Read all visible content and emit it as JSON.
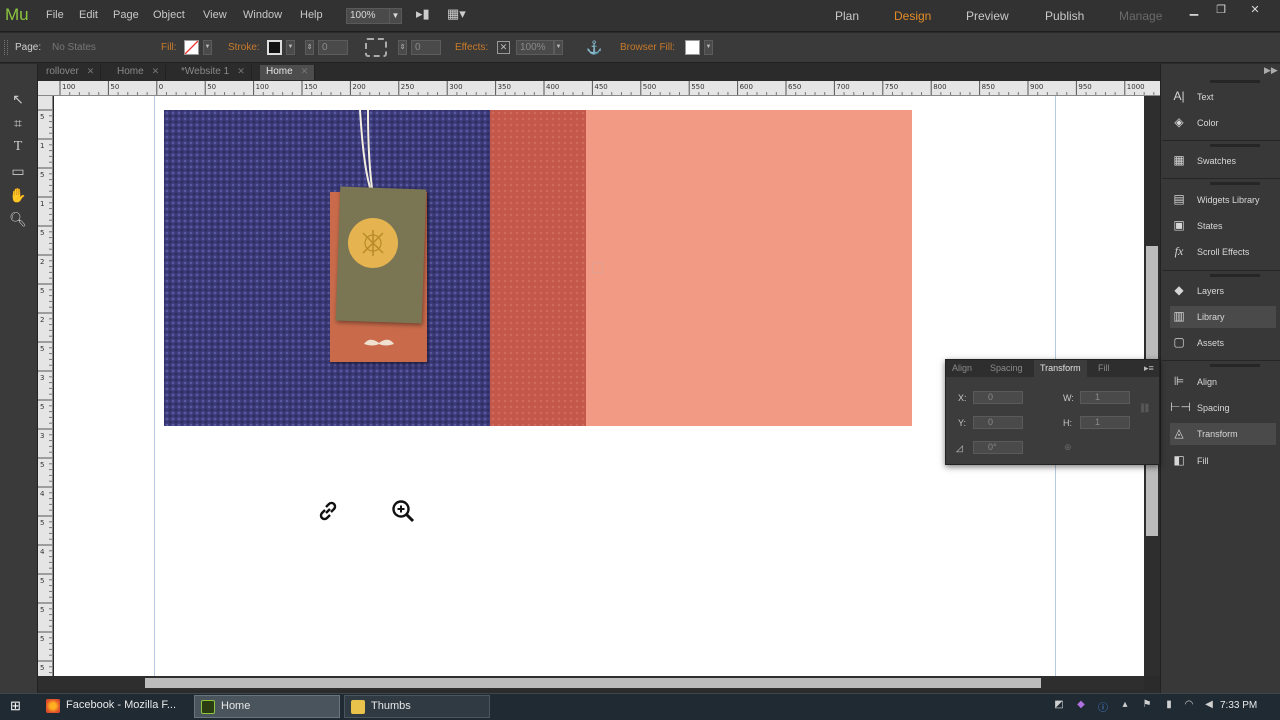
{
  "app": {
    "logo": "Mu",
    "menu": [
      "File",
      "Edit",
      "Page",
      "Object",
      "View",
      "Window",
      "Help"
    ],
    "zoom": "100%",
    "modes": [
      "Plan",
      "Design",
      "Preview",
      "Publish",
      "Manage"
    ],
    "active_mode": "Design"
  },
  "controlbar": {
    "page_label": "Page:",
    "page_state": "No States",
    "fill_label": "Fill:",
    "stroke_label": "Stroke:",
    "stroke_width": "0",
    "corner_radius": "0",
    "effects_label": "Effects:",
    "opacity": "100%",
    "browser_fill_label": "Browser Fill:"
  },
  "tabs": [
    {
      "label": "rollover",
      "active": false
    },
    {
      "label": "Home",
      "active": false
    },
    {
      "label": "*Website 1",
      "active": false
    },
    {
      "label": "Home",
      "active": true
    }
  ],
  "ruler": {
    "h_labels": [
      "100",
      "50",
      "0",
      "50",
      "100",
      "150",
      "200",
      "250",
      "300",
      "350",
      "400",
      "450",
      "500",
      "550",
      "600",
      "650",
      "700",
      "750",
      "800",
      "850",
      "900",
      "950",
      "1000",
      "1050"
    ],
    "v_labels": [
      "5",
      "1",
      "5",
      "1",
      "5",
      "2",
      "5",
      "2",
      "5",
      "3",
      "5",
      "3",
      "5",
      "4",
      "5",
      "4",
      "5",
      "5",
      "5",
      "5"
    ]
  },
  "right_panel": {
    "groups": [
      [
        "Text",
        "Color"
      ],
      [
        "Swatches"
      ],
      [
        "Widgets Library",
        "States",
        "Scroll Effects"
      ],
      [
        "Layers",
        "Library",
        "Assets"
      ],
      [
        "Align",
        "Spacing",
        "Transform",
        "Fill"
      ]
    ],
    "active_item": "Transform"
  },
  "transform_panel": {
    "tabs": [
      "Align",
      "Spacing",
      "Transform",
      "Fill"
    ],
    "active_tab": "Transform",
    "x_label": "X:",
    "x_value": "0",
    "y_label": "Y:",
    "y_value": "0",
    "w_label": "W:",
    "w_value": "1",
    "h_label": "H:",
    "h_value": "1",
    "rotation_value": "0°"
  },
  "taskbar": {
    "buttons": [
      "Facebook - Mozilla F...",
      "Home",
      "Thumbs"
    ],
    "active": "Home",
    "time": "7:33 PM"
  },
  "colors": {
    "accent_orange": "#e38b26",
    "fabric_navy": "#3b3a78",
    "stripe_red": "#c2574a",
    "peach": "#f39a85"
  }
}
